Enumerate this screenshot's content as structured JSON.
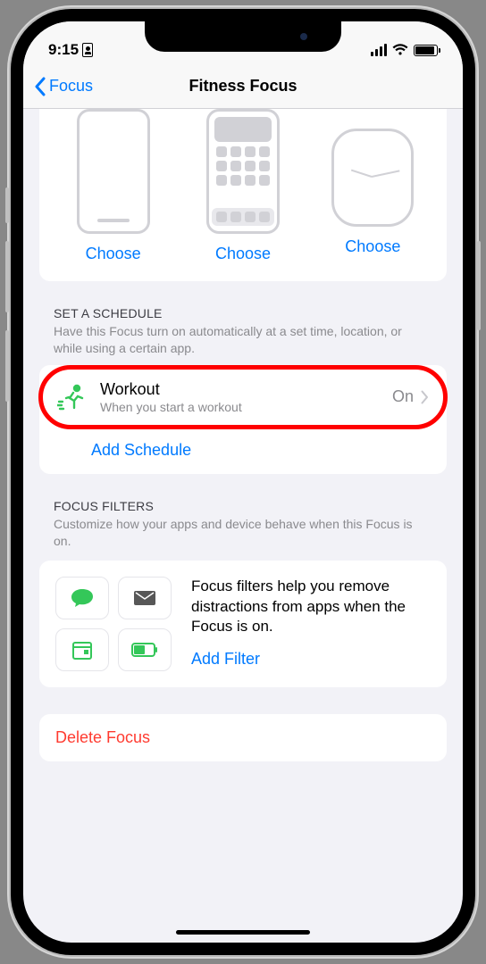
{
  "status": {
    "time": "9:15"
  },
  "nav": {
    "back": "Focus",
    "title": "Fitness Focus"
  },
  "customize": {
    "choose": "Choose"
  },
  "schedule": {
    "heading": "SET A SCHEDULE",
    "sub": "Have this Focus turn on automatically at a set time, location, or while using a certain app.",
    "row": {
      "title": "Workout",
      "sub": "When you start a workout",
      "state": "On"
    },
    "add": "Add Schedule"
  },
  "filters": {
    "heading": "FOCUS FILTERS",
    "sub": "Customize how your apps and device behave when this Focus is on.",
    "desc": "Focus filters help you remove distractions from apps when the Focus is on.",
    "add": "Add Filter"
  },
  "delete": {
    "label": "Delete Focus"
  }
}
